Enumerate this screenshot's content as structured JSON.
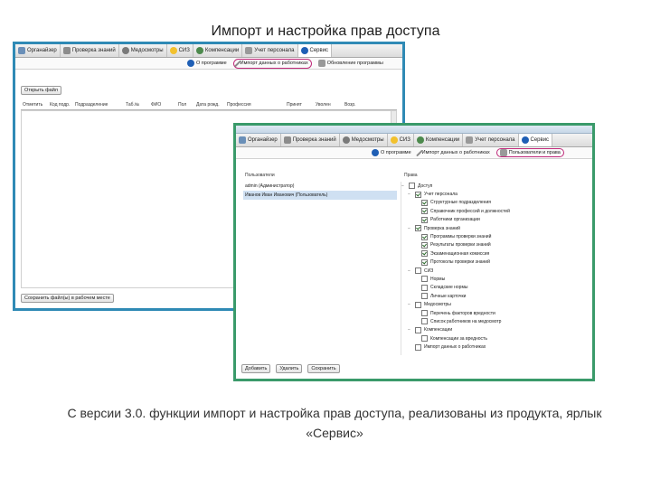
{
  "slide": {
    "title": "Импорт и настройка прав доступа",
    "caption": "С версии 3.0. функции  импорт и настройка прав доступа, реализованы из продукта, ярлык «Сервис»"
  },
  "nav": {
    "items": [
      {
        "label": "Органайзер",
        "icon": "house-icon"
      },
      {
        "label": "Проверка знаний",
        "icon": "book-icon"
      },
      {
        "label": "Медосмотры",
        "icon": "people-icon"
      },
      {
        "label": "СИЗ",
        "icon": "coin-icon"
      },
      {
        "label": "Компенсации",
        "icon": "gear-icon"
      },
      {
        "label": "Учет персонала",
        "icon": "users-icon"
      },
      {
        "label": "Сервис",
        "icon": "info-icon"
      }
    ]
  },
  "win1": {
    "subnav": [
      "О программе",
      "Импорт данных о работниках",
      "Обновление программы"
    ],
    "open_file": "Открыть файл",
    "columns": [
      "Отметить",
      "Код подр.",
      "Подразделение",
      "Таб.№",
      "ФИО",
      "Пол",
      "Дата рожд.",
      "Профессия",
      "Принят",
      "Уволен",
      "Возр."
    ],
    "save_button": "Сохранить файл(ы) в рабочем месте"
  },
  "win2": {
    "subnav": [
      "О программе",
      "Импорт данных о работниках",
      "Пользователи и права"
    ],
    "users_label": "Пользователи",
    "rights_label": "Права",
    "users": [
      "admin (Администратор)",
      "Иванов Иван Иванович (Пользователь)"
    ],
    "tree": [
      {
        "level": 0,
        "label": "Доступ",
        "checked": false,
        "toggle": "−"
      },
      {
        "level": 1,
        "label": "Учет персонала",
        "checked": true,
        "toggle": "−"
      },
      {
        "level": 2,
        "label": "Структурные подразделения",
        "checked": true,
        "toggle": ""
      },
      {
        "level": 2,
        "label": "Справочник профессий и должностей",
        "checked": true,
        "toggle": ""
      },
      {
        "level": 2,
        "label": "Работники организации",
        "checked": true,
        "toggle": ""
      },
      {
        "level": 1,
        "label": "Проверка знаний",
        "checked": true,
        "toggle": "−"
      },
      {
        "level": 2,
        "label": "Программы проверки знаний",
        "checked": true,
        "toggle": ""
      },
      {
        "level": 2,
        "label": "Результаты проверки знаний",
        "checked": true,
        "toggle": ""
      },
      {
        "level": 2,
        "label": "Экзаменационная комиссия",
        "checked": true,
        "toggle": ""
      },
      {
        "level": 2,
        "label": "Протоколы проверки знаний",
        "checked": true,
        "toggle": ""
      },
      {
        "level": 1,
        "label": "СИЗ",
        "checked": false,
        "toggle": "−"
      },
      {
        "level": 2,
        "label": "Нормы",
        "checked": false,
        "toggle": ""
      },
      {
        "level": 2,
        "label": "Складские нормы",
        "checked": false,
        "toggle": ""
      },
      {
        "level": 2,
        "label": "Личные карточки",
        "checked": false,
        "toggle": ""
      },
      {
        "level": 1,
        "label": "Медосмотры",
        "checked": false,
        "toggle": "−"
      },
      {
        "level": 2,
        "label": "Перечень факторов вредности",
        "checked": false,
        "toggle": ""
      },
      {
        "level": 2,
        "label": "Список работников на медосмотр",
        "checked": false,
        "toggle": ""
      },
      {
        "level": 1,
        "label": "Компенсации",
        "checked": false,
        "toggle": "−"
      },
      {
        "level": 2,
        "label": "Компенсации за вредность",
        "checked": false,
        "toggle": ""
      },
      {
        "level": 1,
        "label": "Импорт данных о работниках",
        "checked": false,
        "toggle": ""
      }
    ],
    "buttons": [
      "Добавить",
      "Удалить",
      "Сохранить"
    ]
  }
}
